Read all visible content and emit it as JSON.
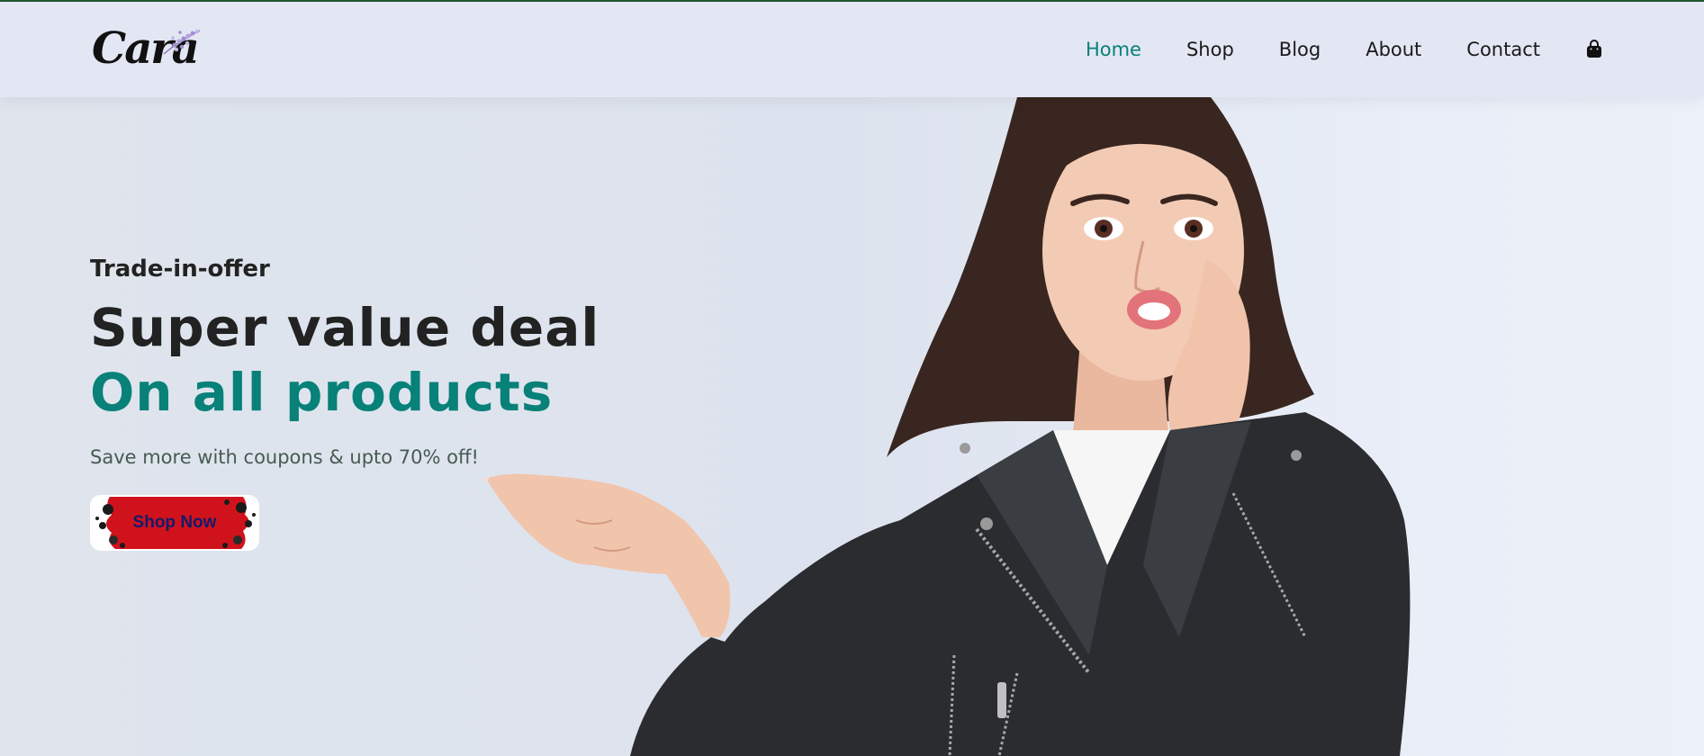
{
  "brand": {
    "logo_text": "Cara"
  },
  "nav": {
    "items": [
      {
        "label": "Home",
        "active": true
      },
      {
        "label": "Shop",
        "active": false
      },
      {
        "label": "Blog",
        "active": false
      },
      {
        "label": "About",
        "active": false
      },
      {
        "label": "Contact",
        "active": false
      }
    ],
    "cart_icon": "shopping-bag-icon"
  },
  "hero": {
    "offer": "Trade-in-offer",
    "title_line1": "Super value deal",
    "title_line2": "On all products",
    "subtitle": "Save more with coupons & upto 70% off!",
    "button_label": "Shop Now"
  },
  "colors": {
    "accent": "#088178",
    "header_bg": "#e3e6f3",
    "heading": "#222222",
    "button_bg": "#d0121c",
    "button_text": "#141a6b"
  }
}
